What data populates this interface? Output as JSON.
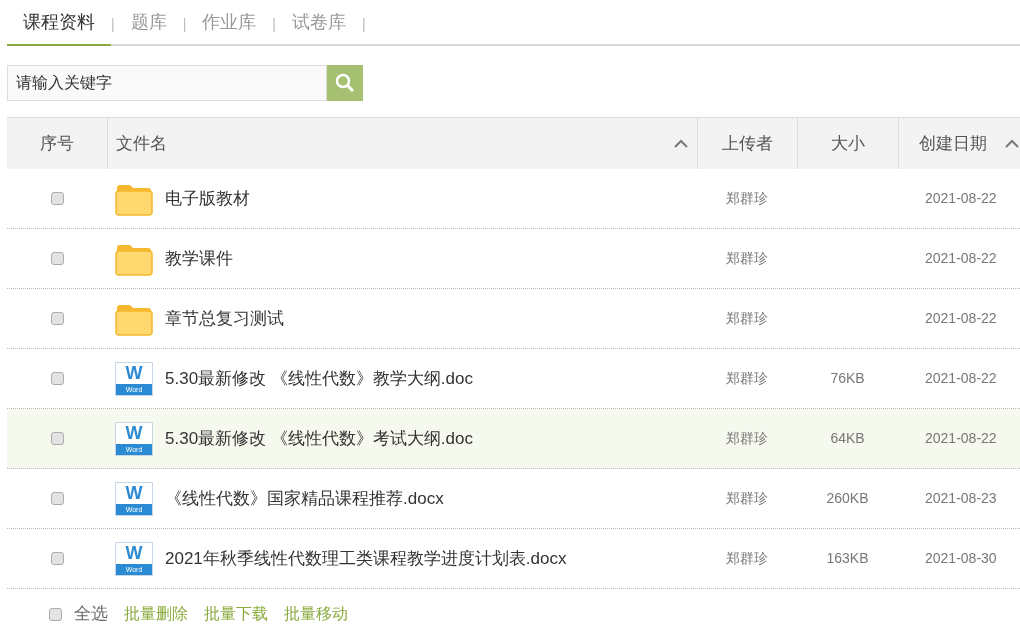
{
  "tabs": [
    {
      "label": "课程资料",
      "selected": true
    },
    {
      "label": "题库",
      "selected": false
    },
    {
      "label": "作业库",
      "selected": false
    },
    {
      "label": "试卷库",
      "selected": false
    }
  ],
  "tab_separator": "|",
  "search": {
    "placeholder": "请输入关键字"
  },
  "table": {
    "columns": [
      {
        "label": "序号",
        "sorted": false
      },
      {
        "label": "文件名",
        "sorted": true
      },
      {
        "label": "上传者",
        "sorted": false
      },
      {
        "label": "大小",
        "sorted": false
      },
      {
        "label": "创建日期",
        "sorted": true
      }
    ],
    "rows": [
      {
        "kind": "folder",
        "checked": false,
        "highlighted": false,
        "name": "电子版教材",
        "uploader": "郑群珍",
        "date": "2021-08-22"
      },
      {
        "kind": "folder",
        "checked": false,
        "highlighted": false,
        "name": "教学课件",
        "uploader": "郑群珍",
        "date": "2021-08-22"
      },
      {
        "kind": "folder",
        "checked": false,
        "highlighted": false,
        "name": "章节总复习测试",
        "uploader": "郑群珍",
        "date": "2021-08-22"
      },
      {
        "kind": "word",
        "checked": false,
        "highlighted": false,
        "icon_letter": "W",
        "icon_caption": "Word",
        "name": "5.30最新修改 《线性代数》教学大纲.doc",
        "uploader": "郑群珍",
        "size": "76KB",
        "date": "2021-08-22"
      },
      {
        "kind": "word",
        "checked": false,
        "highlighted": true,
        "icon_letter": "W",
        "icon_caption": "Word",
        "name": "5.30最新修改 《线性代数》考试大纲.doc",
        "uploader": "郑群珍",
        "size": "64KB",
        "date": "2021-08-22"
      },
      {
        "kind": "word",
        "checked": false,
        "highlighted": false,
        "icon_letter": "W",
        "icon_caption": "Word",
        "name": "《线性代数》国家精品课程推荐.docx",
        "uploader": "郑群珍",
        "size": "260KB",
        "date": "2021-08-23"
      },
      {
        "kind": "word",
        "checked": false,
        "highlighted": false,
        "icon_letter": "W",
        "icon_caption": "Word",
        "name": "2021年秋季线性代数理工类课程教学进度计划表.docx",
        "uploader": "郑群珍",
        "size": "163KB",
        "date": "2021-08-30"
      }
    ]
  },
  "footer": {
    "select_all": {
      "label": "全选",
      "checked": false
    },
    "actions": [
      "批量删除",
      "批量下载",
      "批量移动"
    ]
  }
}
